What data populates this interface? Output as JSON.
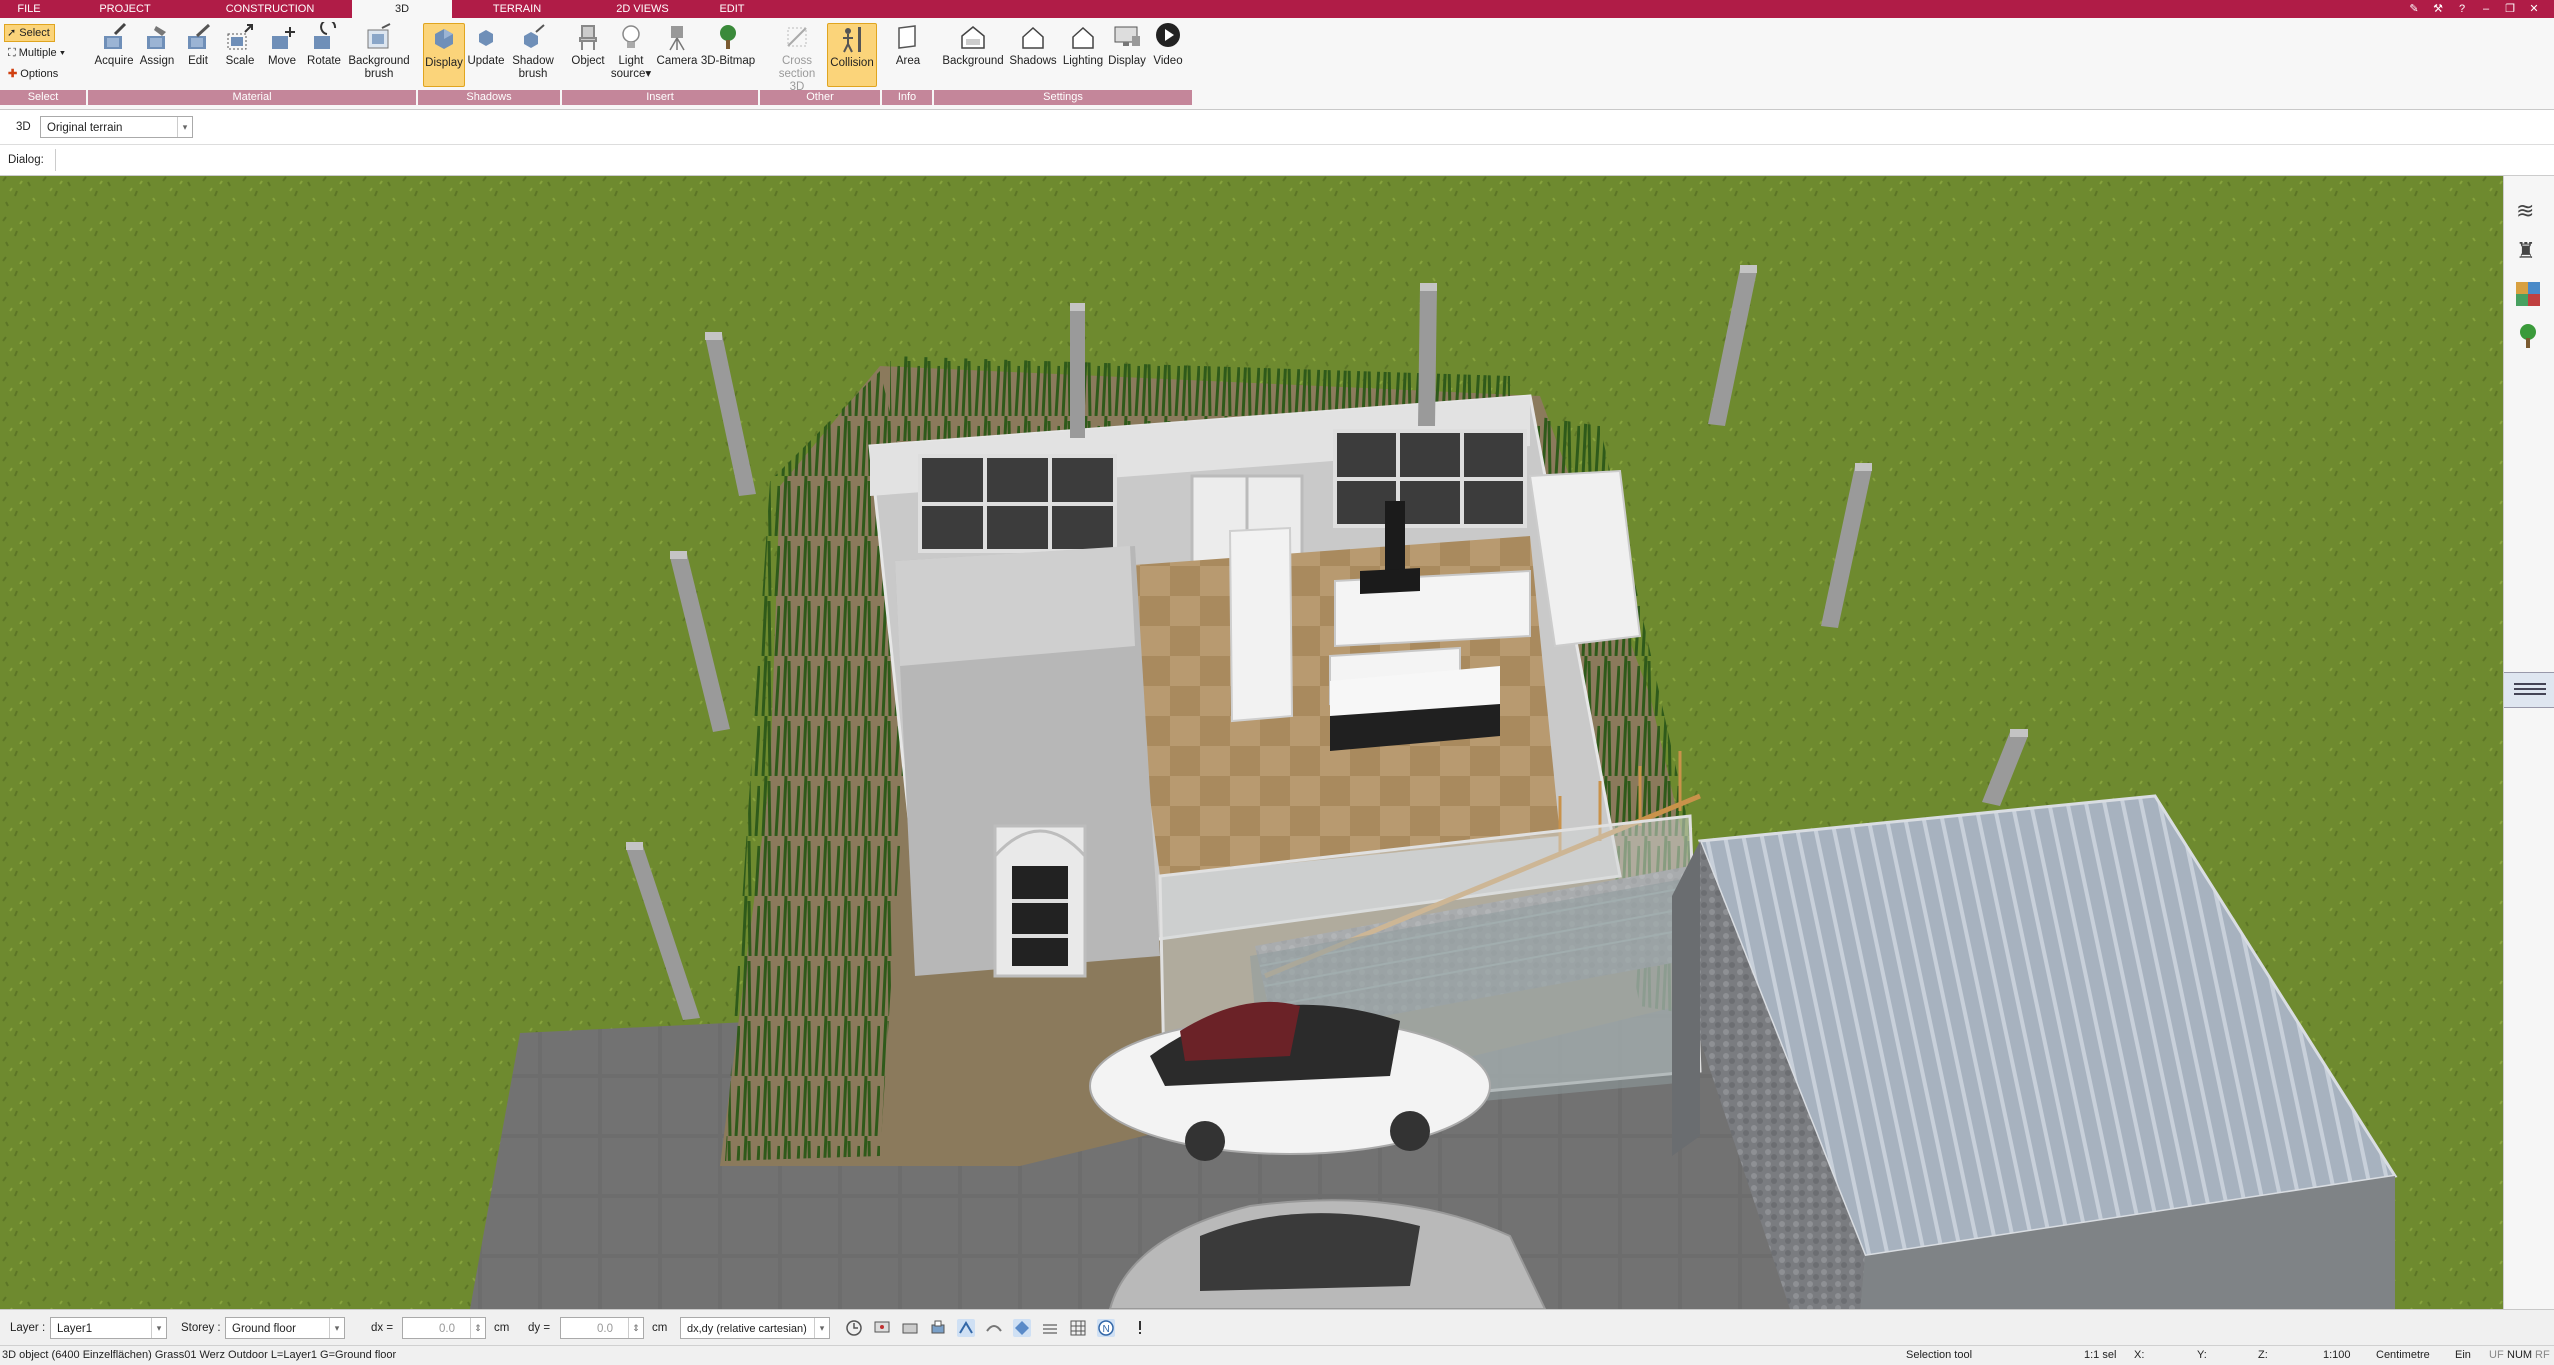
{
  "tabs": [
    "FILE",
    "PROJECT",
    "CONSTRUCTION",
    "3D",
    "TERRAIN",
    "2D VIEWS",
    "EDIT"
  ],
  "active_tab": "3D",
  "select_panel": {
    "select": "Select",
    "multiple": "Multiple",
    "options": "Options"
  },
  "ribbon": {
    "material": [
      "Acquire",
      "Assign",
      "Edit",
      "Scale",
      "Move",
      "Rotate",
      "Background",
      "brush"
    ],
    "shadows": [
      "Display",
      "Update",
      "Shadow",
      "brush"
    ],
    "insert": [
      "Object",
      "Light",
      "source",
      "Camera",
      "3D-Bitmap"
    ],
    "other": [
      "Cross",
      "section 3D",
      "Collision"
    ],
    "info": [
      "Area"
    ],
    "settings": [
      "Background",
      "Shadows",
      "Lighting",
      "Display",
      "Video"
    ]
  },
  "groups": {
    "select": "Select",
    "material": "Material",
    "shadows": "Shadows",
    "insert": "Insert",
    "other": "Other",
    "info": "Info",
    "settings": "Settings"
  },
  "view": {
    "mode": "3D",
    "terrain": "Original terrain",
    "dialog_label": "Dialog:"
  },
  "bottom": {
    "layer_label": "Layer :",
    "layer_value": "Layer1",
    "storey_label": "Storey :",
    "storey_value": "Ground floor",
    "dx_label": "dx =",
    "dx_value": "0.0",
    "dx_unit": "cm",
    "dy_label": "dy =",
    "dy_value": "0.0",
    "dy_unit": "cm",
    "coord_mode": "dx,dy (relative cartesian)"
  },
  "status": {
    "object": "3D object (6400 Einzelflächen) Grass01 Werz Outdoor L=Layer1 G=Ground floor",
    "tool": "Selection tool",
    "sel": "1:1 sel",
    "x": "X:",
    "y": "Y:",
    "z": "Z:",
    "scale": "1:100",
    "unit": "Centimetre",
    "ein": "Ein",
    "uf": "UF",
    "num": "NUM",
    "rf": "RF"
  },
  "colors": {
    "accent": "#b01c47",
    "group": "#c4869a",
    "highlight": "#fbd47a",
    "grass": "#6f8a2e"
  }
}
